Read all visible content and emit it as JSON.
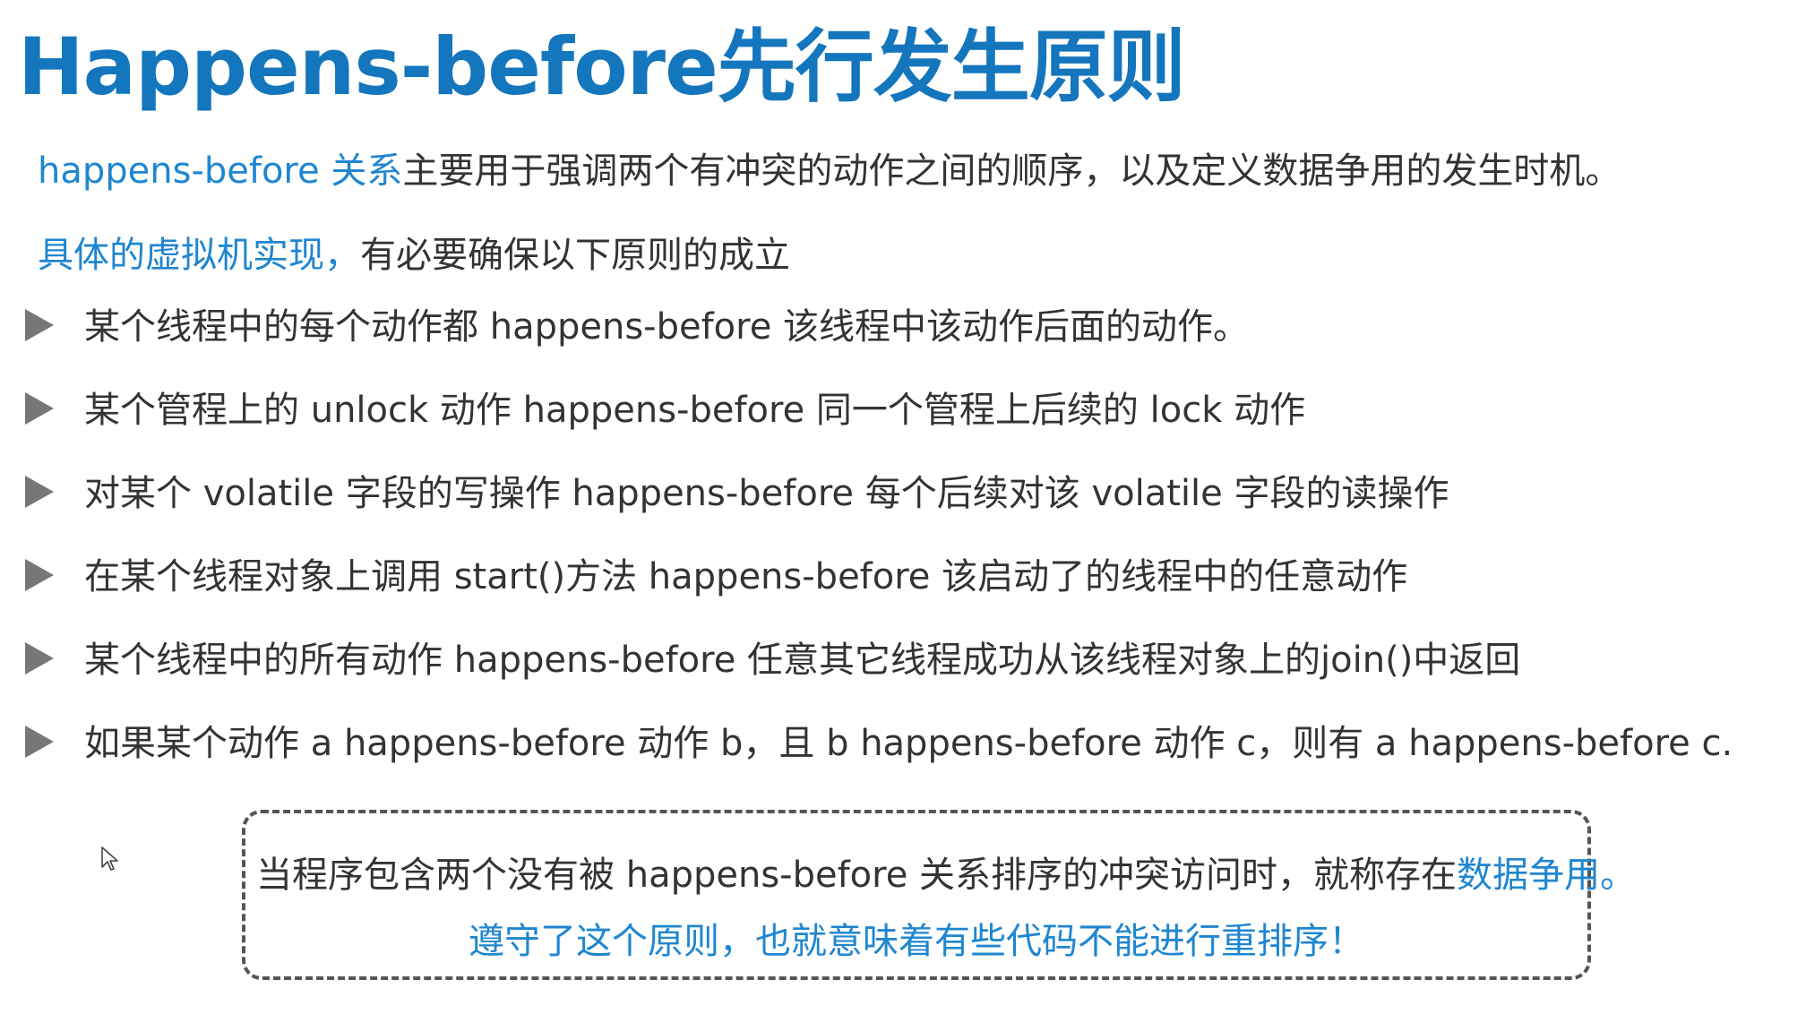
{
  "title": "Happens-before先行发生原则",
  "intro": {
    "line1_highlight": "happens-before 关系",
    "line1_rest": "主要用于强调两个有冲突的动作之间的顺序，以及定义数据争用的发生时机。",
    "line2_highlight": "具体的虚拟机实现，",
    "line2_rest": "有必要确保以下原则的成立"
  },
  "bullets": [
    "某个线程中的每个动作都 happens-before 该线程中该动作后面的动作。",
    "某个管程上的 unlock 动作 happens-before 同一个管程上后续的 lock 动作",
    "对某个 volatile 字段的写操作 happens-before 每个后续对该 volatile 字段的读操作",
    "在某个线程对象上调用 start()方法 happens-before 该启动了的线程中的任意动作",
    "某个线程中的所有动作 happens-before 任意其它线程成功从该线程对象上的join()中返回",
    "如果某个动作 a happens-before 动作 b，且 b happens-before 动作 c，则有 a happens-before c."
  ],
  "note": {
    "line1_text": "当程序包含两个没有被 happens-before 关系排序的冲突访问时，就称存在",
    "line1_highlight": "数据争用。",
    "line2": "遵守了这个原则，也就意味着有些代码不能进行重排序！"
  },
  "icons": {
    "bullet": "triangle-right-icon",
    "cursor": "mouse-cursor-icon"
  },
  "colors": {
    "title": "#1476bd",
    "highlight": "#1f86d0",
    "text": "#333333",
    "bullet": "#777777"
  }
}
